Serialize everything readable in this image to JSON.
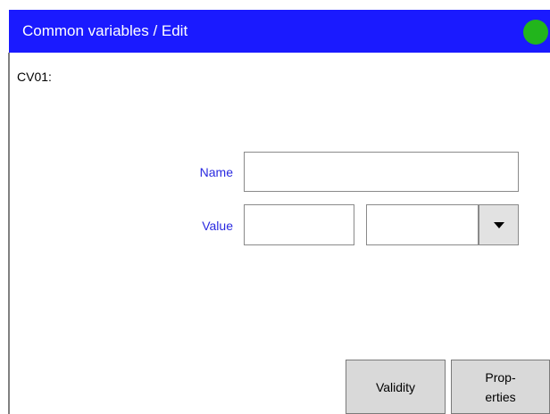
{
  "header": {
    "title": "Common variables / Edit",
    "status_icon": "status-indicator-green",
    "status_color": "#22b51c",
    "accent_color": "#1a1aff"
  },
  "variable": {
    "id_label": "CV01:"
  },
  "form": {
    "name_label": "Name",
    "name_value": "",
    "value_label": "Value",
    "value_value": "",
    "unit_value": ""
  },
  "buttons": {
    "validity_label": "Validity",
    "properties_label_line1": "Prop-",
    "properties_label_line2": "erties"
  }
}
